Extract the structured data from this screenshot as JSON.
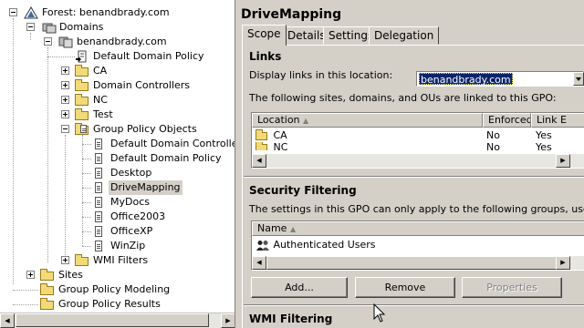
{
  "tree": {
    "root": "Forest: benandbrady.com",
    "domains": "Domains",
    "domain": "benandbrady.com",
    "ddp": "Default Domain Policy",
    "ou_ca": "CA",
    "ou_dc": "Domain Controllers",
    "ou_nc": "NC",
    "ou_test": "Test",
    "gpo_container": "Group Policy Objects",
    "gpos": [
      "Default Domain Controlle",
      "Default Domain Policy",
      "Desktop",
      "DriveMapping",
      "MyDocs",
      "Office2003",
      "OfficeXP",
      "WinZip"
    ],
    "wmi": "WMI Filters",
    "sites": "Sites",
    "modeling": "Group Policy Modeling",
    "results": "Group Policy Results"
  },
  "detail": {
    "title": "DriveMapping",
    "tabs": [
      "Scope",
      "Details",
      "Settings",
      "Delegation"
    ],
    "links": {
      "heading": "Links",
      "display_label": "Display links in this location:",
      "location_value": "benandbrady.com",
      "description": "The following sites, domains, and OUs are linked to this GPO:",
      "columns": [
        "Location",
        "Enforced",
        "Link E"
      ],
      "rows": [
        {
          "location": "CA",
          "enforced": "No",
          "link_enabled": "Yes"
        },
        {
          "location": "NC",
          "enforced": "No",
          "link_enabled": "Yes"
        }
      ]
    },
    "security": {
      "heading": "Security Filtering",
      "description": "The settings in this GPO can only apply to the following groups, users, and",
      "column": "Name",
      "rows": [
        "Authenticated Users"
      ],
      "buttons": {
        "add": "Add...",
        "remove": "Remove",
        "properties": "Properties"
      }
    },
    "wmi": {
      "heading": "WMI Filtering"
    }
  }
}
